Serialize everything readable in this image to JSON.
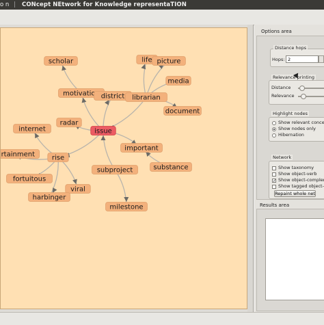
{
  "window": {
    "title_prefix": "o n",
    "separator": "|",
    "title": "CONcept NEtwork for Knowledge representaTION"
  },
  "graph": {
    "focus": "issue",
    "nodes": [
      {
        "id": "scholar",
        "label": "scholar"
      },
      {
        "id": "life",
        "label": "life"
      },
      {
        "id": "picture",
        "label": "picture"
      },
      {
        "id": "media",
        "label": "media"
      },
      {
        "id": "motivation",
        "label": "motivation"
      },
      {
        "id": "district",
        "label": "district"
      },
      {
        "id": "librarian",
        "label": "librarian"
      },
      {
        "id": "document",
        "label": "document"
      },
      {
        "id": "radar",
        "label": "radar"
      },
      {
        "id": "issue",
        "label": "issue"
      },
      {
        "id": "internet",
        "label": "internet"
      },
      {
        "id": "important",
        "label": "important"
      },
      {
        "id": "entertainment",
        "label": "entertainment"
      },
      {
        "id": "rise",
        "label": "rise"
      },
      {
        "id": "substance",
        "label": "substance"
      },
      {
        "id": "subproject",
        "label": "subproject"
      },
      {
        "id": "fortuitous",
        "label": "fortuitous"
      },
      {
        "id": "viral",
        "label": "viral"
      },
      {
        "id": "harbinger",
        "label": "harbinger"
      },
      {
        "id": "milestone",
        "label": "milestone"
      }
    ]
  },
  "options": {
    "title": "Options area",
    "distance_hops": {
      "title": "Distance hops",
      "hops_label": "Hops:",
      "hops_value": "2"
    },
    "relevance": {
      "title": "Relevance printing",
      "distance_label": "Distance",
      "relevance_label": "Relevance"
    },
    "highlight": {
      "title": "Highlight nodes",
      "options": [
        "Show relevant concepts",
        "Show nodes only",
        "Hibernation"
      ],
      "selected": "Show nodes only"
    },
    "network": {
      "title": "Network",
      "options": [
        {
          "label": "Show taxonomy",
          "checked": false
        },
        {
          "label": "Show object-verb",
          "checked": false
        },
        {
          "label": "Show object-complement",
          "checked": true
        },
        {
          "label": "Show tagged object-c",
          "checked": false
        }
      ],
      "repaint_label": "Repaint whole net"
    }
  },
  "results": {
    "title": "Results area"
  }
}
